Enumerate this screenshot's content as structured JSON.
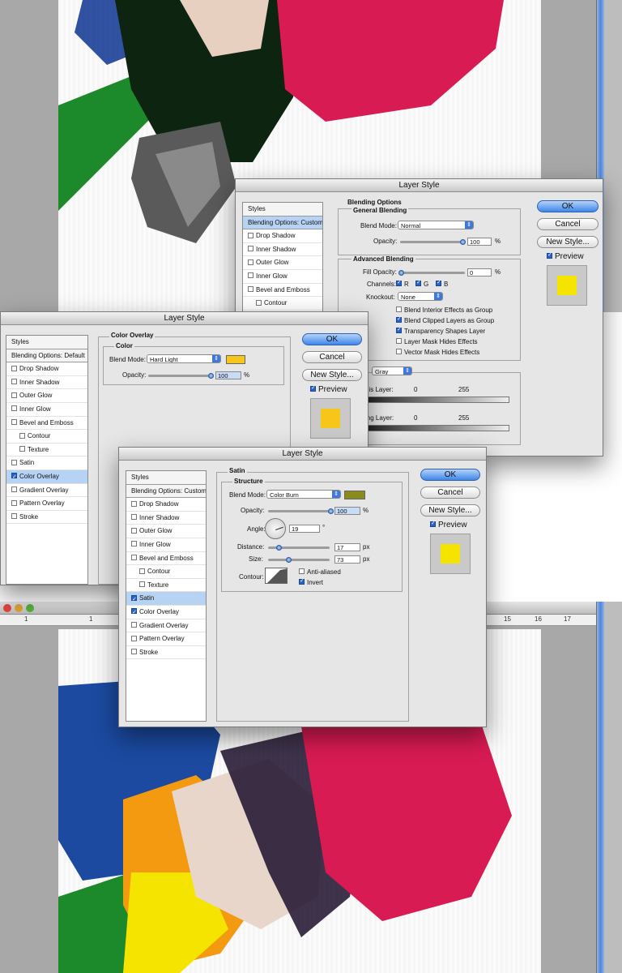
{
  "colors": {
    "accent": "#3f78d6",
    "swatch_yellow": "#f7c61a",
    "satin_swatch": "#8a8a1d",
    "preview_yellow": "#f5e400"
  },
  "ruler_bottom": [
    "1",
    "1",
    "15",
    "16",
    "17"
  ],
  "dialog1": {
    "title": "Layer Style",
    "styles": {
      "header": "Styles",
      "blending": "Blending Options: Custom",
      "items": [
        {
          "label": "Drop Shadow",
          "checked": false
        },
        {
          "label": "Inner Shadow",
          "checked": false
        },
        {
          "label": "Outer Glow",
          "checked": false
        },
        {
          "label": "Inner Glow",
          "checked": false
        },
        {
          "label": "Bevel and Emboss",
          "checked": false
        },
        {
          "label": "Contour",
          "checked": false
        }
      ]
    },
    "blending_options": {
      "title": "Blending Options",
      "general": {
        "title": "General Blending",
        "blend_mode_label": "Blend Mode:",
        "blend_mode": "Normal",
        "opacity_label": "Opacity:",
        "opacity": "100",
        "unit": "%"
      },
      "advanced": {
        "title": "Advanced Blending",
        "fill_opacity_label": "Fill Opacity:",
        "fill_opacity": "0",
        "unit": "%",
        "channels_label": "Channels:",
        "channels": [
          "R",
          "G",
          "B"
        ],
        "knockout_label": "Knockout:",
        "knockout": "None",
        "checks": [
          {
            "label": "Blend Interior Effects as Group",
            "checked": false
          },
          {
            "label": "Blend Clipped Layers as Group",
            "checked": true
          },
          {
            "label": "Transparency Shapes Layer",
            "checked": true
          },
          {
            "label": "Layer Mask Hides Effects",
            "checked": false
          },
          {
            "label": "Vector Mask Hides Effects",
            "checked": false
          }
        ]
      },
      "blend_if": "Gray",
      "this_layer_label": "his Layer:",
      "underlying_label": "ing Layer:",
      "range_min": "0",
      "range_max": "255"
    },
    "buttons": {
      "ok": "OK",
      "cancel": "Cancel",
      "new_style": "New Style...",
      "preview": "Preview"
    }
  },
  "dialog2": {
    "title": "Layer Style",
    "styles": {
      "header": "Styles",
      "blending": "Blending Options: Default",
      "items": [
        {
          "label": "Drop Shadow",
          "checked": false,
          "indent": false,
          "selected": false
        },
        {
          "label": "Inner Shadow",
          "checked": false,
          "indent": false,
          "selected": false
        },
        {
          "label": "Outer Glow",
          "checked": false,
          "indent": false,
          "selected": false
        },
        {
          "label": "Inner Glow",
          "checked": false,
          "indent": false,
          "selected": false
        },
        {
          "label": "Bevel and Emboss",
          "checked": false,
          "indent": false,
          "selected": false
        },
        {
          "label": "Contour",
          "checked": false,
          "indent": true,
          "selected": false
        },
        {
          "label": "Texture",
          "checked": false,
          "indent": true,
          "selected": false
        },
        {
          "label": "Satin",
          "checked": false,
          "indent": false,
          "selected": false
        },
        {
          "label": "Color Overlay",
          "checked": true,
          "indent": false,
          "selected": true
        },
        {
          "label": "Gradient Overlay",
          "checked": false,
          "indent": false,
          "selected": false
        },
        {
          "label": "Pattern Overlay",
          "checked": false,
          "indent": false,
          "selected": false
        },
        {
          "label": "Stroke",
          "checked": false,
          "indent": false,
          "selected": false
        }
      ]
    },
    "color_overlay": {
      "title": "Color Overlay",
      "group": "Color",
      "blend_mode_label": "Blend Mode:",
      "blend_mode": "Hard Light",
      "opacity_label": "Opacity:",
      "opacity": "100",
      "unit": "%"
    },
    "buttons": {
      "ok": "OK",
      "cancel": "Cancel",
      "new_style": "New Style...",
      "preview": "Preview"
    }
  },
  "dialog3": {
    "title": "Layer Style",
    "styles": {
      "header": "Styles",
      "blending": "Blending Options: Custom",
      "items": [
        {
          "label": "Drop Shadow",
          "checked": false,
          "indent": false,
          "selected": false
        },
        {
          "label": "Inner Shadow",
          "checked": false,
          "indent": false,
          "selected": false
        },
        {
          "label": "Outer Glow",
          "checked": false,
          "indent": false,
          "selected": false
        },
        {
          "label": "Inner Glow",
          "checked": false,
          "indent": false,
          "selected": false
        },
        {
          "label": "Bevel and Emboss",
          "checked": false,
          "indent": false,
          "selected": false
        },
        {
          "label": "Contour",
          "checked": false,
          "indent": true,
          "selected": false
        },
        {
          "label": "Texture",
          "checked": false,
          "indent": true,
          "selected": false
        },
        {
          "label": "Satin",
          "checked": true,
          "indent": false,
          "selected": true
        },
        {
          "label": "Color Overlay",
          "checked": true,
          "indent": false,
          "selected": false
        },
        {
          "label": "Gradient Overlay",
          "checked": false,
          "indent": false,
          "selected": false
        },
        {
          "label": "Pattern Overlay",
          "checked": false,
          "indent": false,
          "selected": false
        },
        {
          "label": "Stroke",
          "checked": false,
          "indent": false,
          "selected": false
        }
      ]
    },
    "satin": {
      "title": "Satin",
      "group": "Structure",
      "blend_mode_label": "Blend Mode:",
      "blend_mode": "Color Burn",
      "opacity_label": "Opacity:",
      "opacity": "100",
      "angle_label": "Angle:",
      "angle": "19",
      "angle_unit": "°",
      "distance_label": "Distance:",
      "distance": "17",
      "size_label": "Size:",
      "size": "73",
      "px": "px",
      "percent": "%",
      "contour_label": "Contour:",
      "anti_aliased": "Anti-aliased",
      "invert": "Invert"
    },
    "buttons": {
      "ok": "OK",
      "cancel": "Cancel",
      "new_style": "New Style...",
      "preview": "Preview"
    }
  }
}
